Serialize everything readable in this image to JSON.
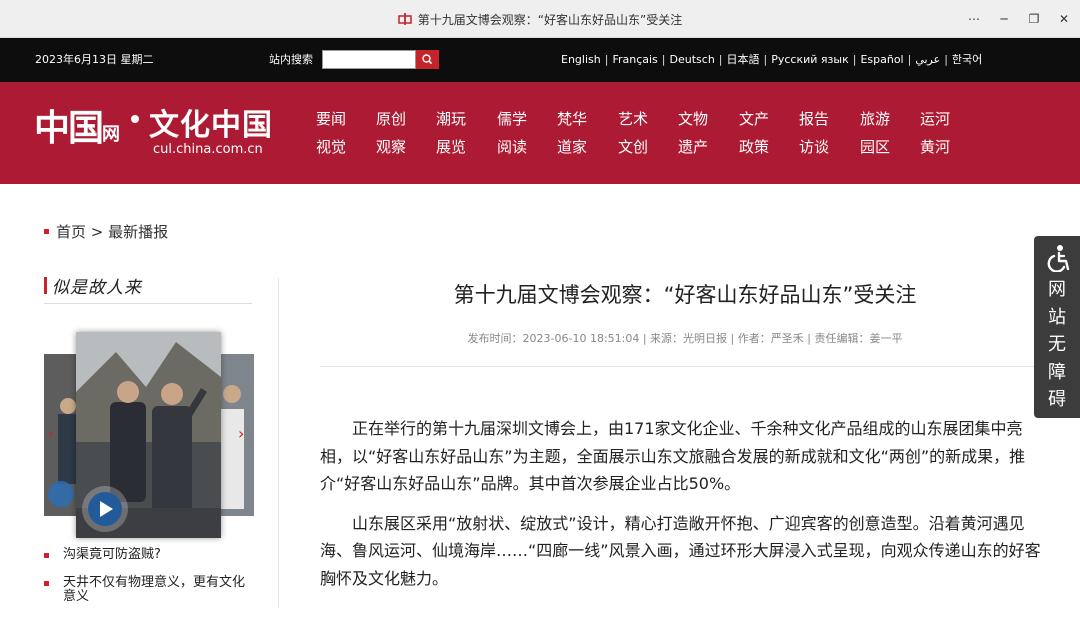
{
  "window": {
    "title": "第十九届文博会观察：“好客山东好品山东”受关注",
    "controls": [
      "⋯",
      "─",
      "❐",
      "✕"
    ]
  },
  "topbar": {
    "date": "2023年6月13日 星期二",
    "search_label": "站内搜索",
    "search_value": "",
    "languages": [
      "English",
      "Français",
      "Deutsch",
      "日本語",
      "Русский язык",
      "Español",
      "عربي",
      "한국어"
    ]
  },
  "header": {
    "logo_main": "中国",
    "logo_wang": "网",
    "logo_cn": "文化中国",
    "logo_url": "cul.china.com.cn",
    "nav_columns": [
      [
        "要闻",
        "视觉"
      ],
      [
        "原创",
        "观察"
      ],
      [
        "潮玩",
        "展览"
      ],
      [
        "儒学",
        "阅读"
      ],
      [
        "梵华",
        "道家"
      ],
      [
        "艺术",
        "文创"
      ],
      [
        "文物",
        "遗产"
      ],
      [
        "文产",
        "政策"
      ],
      [
        "报告",
        "访谈"
      ],
      [
        "旅游",
        "园区"
      ],
      [
        "运河",
        "黄河"
      ]
    ]
  },
  "breadcrumb": {
    "home": "首页",
    "separator": ">",
    "current": "最新播报"
  },
  "sidebar": {
    "title": "似是故人来",
    "list": [
      "沟渠竟可防盗贼?",
      "天井不仅有物理意义，更有文化意义"
    ]
  },
  "article": {
    "title": "第十九届文博会观察：“好客山东好品山东”受关注",
    "meta": "发布时间：2023-06-10 18:51:04 | 来源：光明日报 | 作者：严圣禾 | 责任编辑：姜一平",
    "paragraphs": [
      "正在举行的第十九届深圳文博会上，由171家文化企业、千余种文化产品组成的山东展团集中亮相，以“好客山东好品山东”为主题，全面展示山东文旅融合发展的新成就和文化“两创”的新成果，推介“好客山东好品山东”品牌。其中首次参展企业占比50%。",
      "山东展区采用“放射状、绽放式”设计，精心打造敞开怀抱、广迎宾客的创意造型。沿着黄河遇见海、鲁风运河、仙境海岸……“四廊一线”风景入画，通过环形大屏浸入式呈现，向观众传递山东的好客胸怀及文化魅力。"
    ]
  },
  "accessibility": {
    "label_chars": [
      "网",
      "站",
      "无",
      "障",
      "碍"
    ]
  },
  "colors": {
    "brand_red": "#ad1a33",
    "accent_red": "#c6242b",
    "topbar_bg": "#0d0d0d"
  }
}
